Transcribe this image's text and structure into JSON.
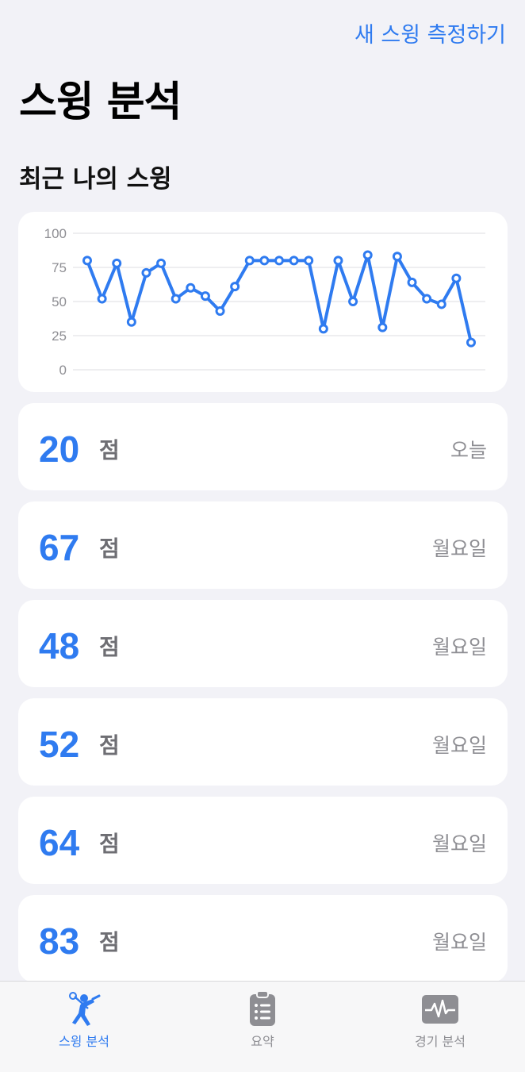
{
  "header": {
    "action_label": "새 스윙 측정하기",
    "title": "스윙 분석",
    "section_title": "최근 나의 스윙"
  },
  "chart_data": {
    "type": "line",
    "y_ticks": [
      "100",
      "75",
      "50",
      "25",
      "0"
    ],
    "ylim": [
      0,
      100
    ],
    "values": [
      80,
      52,
      78,
      35,
      71,
      78,
      52,
      60,
      54,
      43,
      61,
      80,
      80,
      80,
      80,
      80,
      30,
      80,
      50,
      84,
      31,
      83,
      64,
      52,
      48,
      67,
      20
    ],
    "grid": true,
    "line_color": "#2F7BF0"
  },
  "scores": [
    {
      "value": "20",
      "unit": "점",
      "day": "오늘"
    },
    {
      "value": "67",
      "unit": "점",
      "day": "월요일"
    },
    {
      "value": "48",
      "unit": "점",
      "day": "월요일"
    },
    {
      "value": "52",
      "unit": "점",
      "day": "월요일"
    },
    {
      "value": "64",
      "unit": "점",
      "day": "월요일"
    },
    {
      "value": "83",
      "unit": "점",
      "day": "월요일"
    }
  ],
  "tabs": [
    {
      "label": "스윙 분석",
      "icon": "golfer-swing-icon",
      "active": true
    },
    {
      "label": "요약",
      "icon": "clipboard-list-icon",
      "active": false
    },
    {
      "label": "경기 분석",
      "icon": "waveform-monitor-icon",
      "active": false
    }
  ],
  "colors": {
    "accent": "#2F7BF0",
    "background": "#F2F2F7",
    "inactive": "#8e8e93"
  }
}
